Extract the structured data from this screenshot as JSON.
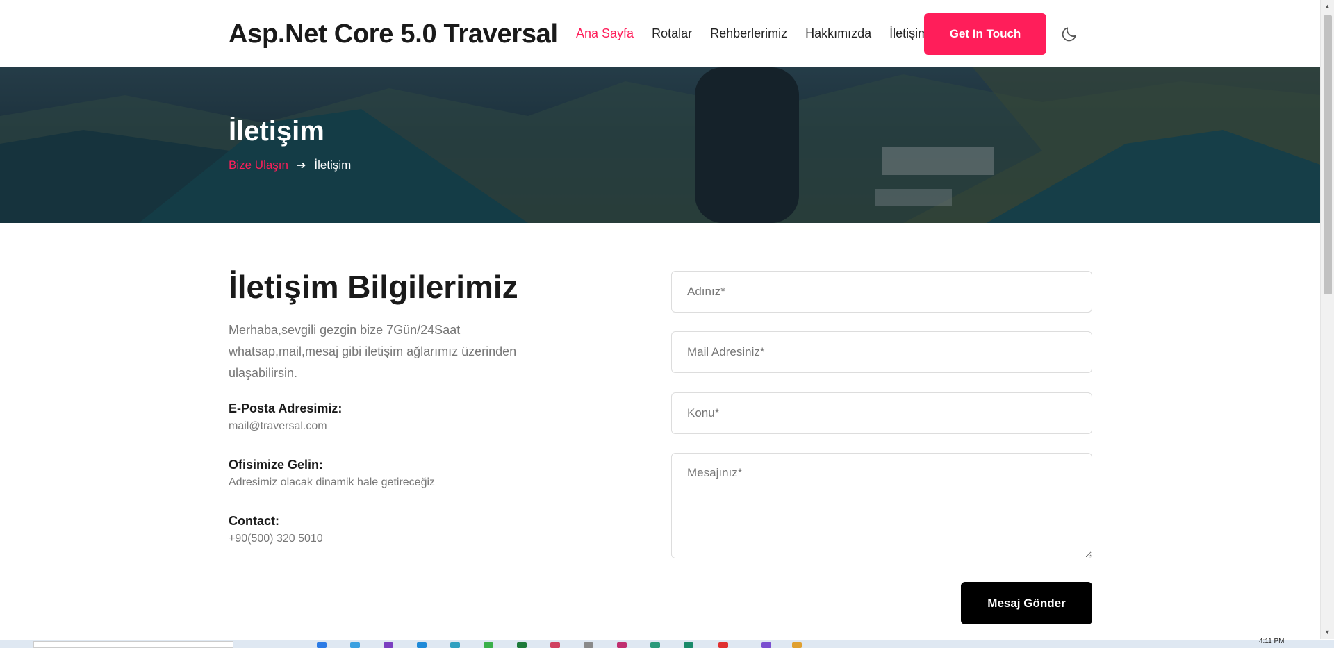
{
  "header": {
    "brand": "Asp.Net Core 5.0 Traversal",
    "nav": [
      {
        "label": "Ana Sayfa",
        "active": true
      },
      {
        "label": "Rotalar",
        "active": false
      },
      {
        "label": "Rehberlerimiz",
        "active": false
      },
      {
        "label": "Hakkımızda",
        "active": false
      },
      {
        "label": "İletişim",
        "active": false
      }
    ],
    "cta_label": "Get In Touch",
    "theme_icon": "moon-icon"
  },
  "hero": {
    "title": "İletişim",
    "breadcrumb_link": "Bize Ulaşın",
    "breadcrumb_current": "İletişim"
  },
  "info": {
    "title": "İletişim Bilgilerimiz",
    "description": "Merhaba,sevgili gezgin bize 7Gün/24Saat whatsap,mail,mesaj gibi iletişim ağlarımız üzerinden ulaşabilirsin.",
    "email_label": "E-Posta Adresimiz:",
    "email_value": "mail@traversal.com",
    "office_label": "Ofisimize Gelin:",
    "office_value": "Adresimiz olacak dinamik hale getireceğiz",
    "contact_label": "Contact:",
    "contact_value": "+90(500) 320 5010"
  },
  "form": {
    "name_placeholder": "Adınız*",
    "mail_placeholder": "Mail Adresiniz*",
    "subject_placeholder": "Konu*",
    "message_placeholder": "Mesajınız*",
    "submit_label": "Mesaj Gönder"
  },
  "taskbar": {
    "time": "4:11 PM"
  },
  "colors": {
    "accent": "#ff1e5a",
    "submit_bg": "#000000"
  }
}
